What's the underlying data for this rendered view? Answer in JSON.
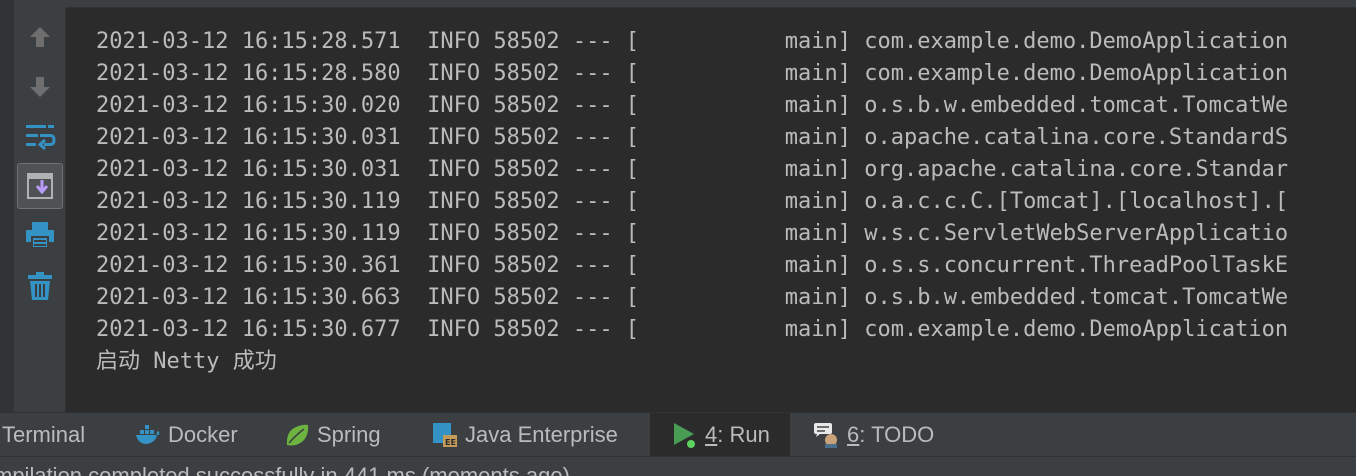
{
  "console": {
    "lines": [
      "2021-03-12 16:15:28.571  INFO 58502 --- [           main] com.example.demo.DemoApplication",
      "2021-03-12 16:15:28.580  INFO 58502 --- [           main] com.example.demo.DemoApplication",
      "2021-03-12 16:15:30.020  INFO 58502 --- [           main] o.s.b.w.embedded.tomcat.TomcatWe",
      "2021-03-12 16:15:30.031  INFO 58502 --- [           main] o.apache.catalina.core.StandardS",
      "2021-03-12 16:15:30.031  INFO 58502 --- [           main] org.apache.catalina.core.Standar",
      "2021-03-12 16:15:30.119  INFO 58502 --- [           main] o.a.c.c.C.[Tomcat].[localhost].[",
      "2021-03-12 16:15:30.119  INFO 58502 --- [           main] w.s.c.ServletWebServerApplicatio",
      "2021-03-12 16:15:30.361  INFO 58502 --- [           main] o.s.s.concurrent.ThreadPoolTaskE",
      "2021-03-12 16:15:30.663  INFO 58502 --- [           main] o.s.b.w.embedded.tomcat.TomcatWe",
      "2021-03-12 16:15:30.677  INFO 58502 --- [           main] com.example.demo.DemoApplication",
      "启动 Netty 成功"
    ]
  },
  "toolbar": {
    "icons": [
      "arrow-up-icon",
      "arrow-down-icon",
      "soft-wrap-icon",
      "scroll-to-end-icon",
      "print-icon",
      "trash-icon"
    ],
    "active_icon": "scroll-to-end-icon"
  },
  "tabs": {
    "terminal": "Terminal",
    "docker": "Docker",
    "spring": "Spring",
    "java_enterprise": "Java Enterprise",
    "run_num": "4",
    "run_label": ": Run",
    "todo_num": "6",
    "todo_label": ": TODO"
  },
  "status": {
    "text": "mpilation completed successfully in 441 ms (moments ago)"
  },
  "colors": {
    "background": "#2b2b2b",
    "panel": "#3c3f41",
    "text": "#bbbbbb",
    "icon_blue": "#3592c4",
    "icon_gray": "#6e6e6e",
    "run_green": "#499c54",
    "spring_green": "#6db33f",
    "merge_purple": "#b99bf8"
  }
}
